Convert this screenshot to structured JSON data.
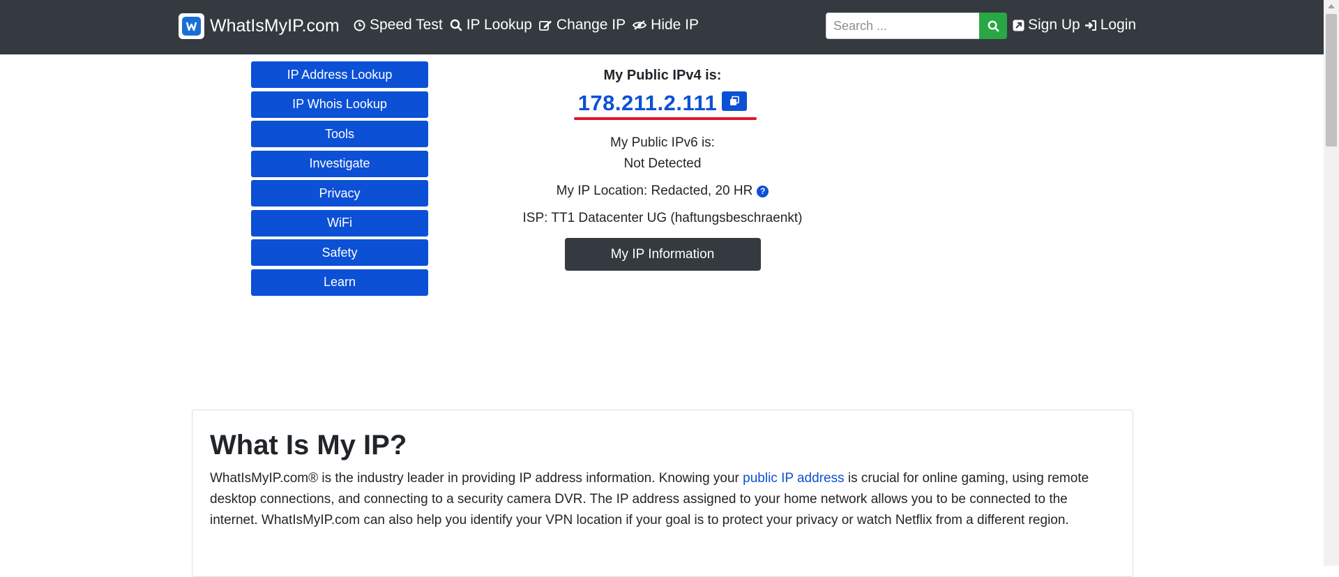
{
  "navbar": {
    "brand": "WhatIsMyIP.com",
    "links": [
      {
        "label": "Speed Test",
        "icon": "clock-icon"
      },
      {
        "label": "IP Lookup",
        "icon": "search-icon"
      },
      {
        "label": "Change IP",
        "icon": "edit-icon"
      },
      {
        "label": "Hide IP",
        "icon": "eye-slash-icon"
      }
    ],
    "search_placeholder": "Search ...",
    "sign_up": "Sign Up",
    "login": "Login",
    "bg_color": "#343a40",
    "search_button_color": "#28a745"
  },
  "sidebar": {
    "items": [
      {
        "label": "IP Address Lookup"
      },
      {
        "label": "IP Whois Lookup"
      },
      {
        "label": "Tools"
      },
      {
        "label": "Investigate"
      },
      {
        "label": "Privacy"
      },
      {
        "label": "WiFi"
      },
      {
        "label": "Safety"
      },
      {
        "label": "Learn"
      }
    ],
    "color": "#0c50d6"
  },
  "ip_info": {
    "ipv4_label": "My Public IPv4 is:",
    "ipv4_value": "178.211.2.111",
    "ipv6_label": "My Public IPv6 is:",
    "ipv6_value": "Not Detected",
    "location": "My IP Location: Redacted, 20 HR",
    "isp": "ISP: TT1 Datacenter UG (haftungsbeschraenkt)",
    "info_button": "My IP Information",
    "highlight_color": "#e4152b"
  },
  "article": {
    "title": "What Is My IP?",
    "text_before_link": "WhatIsMyIP.com® is the industry leader in providing IP address information. Knowing your ",
    "link_text": "public IP address",
    "text_after_link": " is crucial for online gaming, using remote desktop connections, and connecting to a security camera DVR. The IP address assigned to your home network allows you to be connected to the internet. WhatIsMyIP.com can also help you identify your VPN location if your goal is to protect your privacy or watch Netflix from a different region."
  }
}
